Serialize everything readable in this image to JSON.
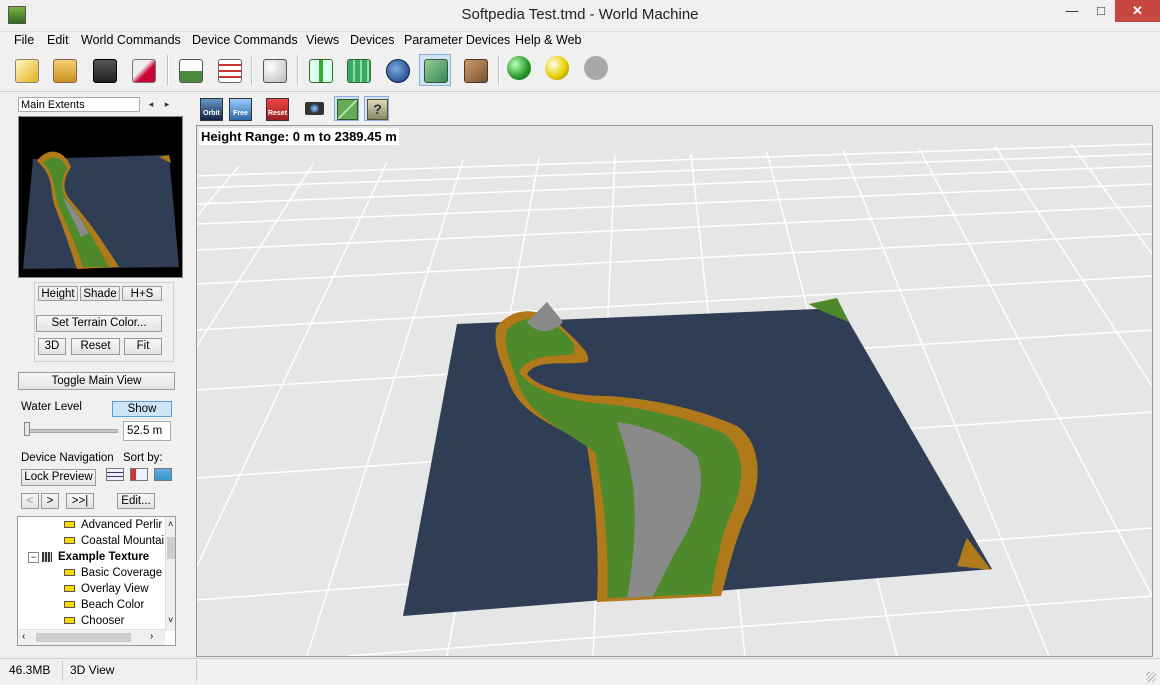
{
  "window": {
    "title": "Softpedia Test.tmd - World Machine",
    "minimize": "—",
    "maximize": "□",
    "close": "✕"
  },
  "menu": [
    "File",
    "Edit",
    "World Commands",
    "Device Commands",
    "Views",
    "Devices",
    "Parameter Devices",
    "Help & Web"
  ],
  "toolbar": {
    "icons": [
      "new-file-icon",
      "open-folder-icon",
      "save-disk-icon",
      "wand-icon",
      "terrain-chart-icon",
      "checklist-icon",
      "dice-icon",
      "device-layout-icon",
      "grid-map-icon",
      "globe-icon",
      "3d-view-icon",
      "texture-icon"
    ],
    "status_colors": [
      "#2e9e2e",
      "#e8d000",
      "#a8a8a8"
    ]
  },
  "left_panel": {
    "extents_label": "Main Extents",
    "buttons_row1": [
      "Height",
      "Shade",
      "H+S"
    ],
    "set_terrain_color": "Set Terrain Color...",
    "buttons_row2": [
      "3D",
      "Reset",
      "Fit"
    ],
    "toggle_main_view": "Toggle Main View",
    "water_level_label": "Water Level",
    "show_button": "Show",
    "water_level_value": "52.5 m",
    "water_level_fraction": 0.03,
    "device_navigation_label": "Device Navigation",
    "sort_by_label": "Sort by:",
    "lock_preview": "Lock Preview",
    "nav_prev": "<",
    "nav_next": ">",
    "nav_last": ">>|",
    "edit_button": "Edit...",
    "tree_items": [
      {
        "label": "Advanced Perlir",
        "type": "device"
      },
      {
        "label": "Coastal Mountai",
        "type": "device"
      },
      {
        "label": "Example Texture",
        "type": "group"
      },
      {
        "label": "Basic Coverage",
        "type": "device"
      },
      {
        "label": "Overlay View",
        "type": "device"
      },
      {
        "label": "Beach Color",
        "type": "device"
      },
      {
        "label": "Chooser",
        "type": "device"
      }
    ]
  },
  "view_toolbar": {
    "buttons": [
      "Orbit",
      "Free",
      "Reset"
    ],
    "extra_icons": [
      "camera-icon",
      "wireframe-icon",
      "help-icon"
    ]
  },
  "viewport": {
    "height_range": "Height Range: 0 m to 2389.45 m"
  },
  "status": {
    "memory": "46.3MB",
    "view": "3D View"
  },
  "colors": {
    "water": "#2f3d55",
    "grass": "#4e8a2b",
    "sand": "#b07a1a",
    "rock": "#8a8a8a"
  }
}
